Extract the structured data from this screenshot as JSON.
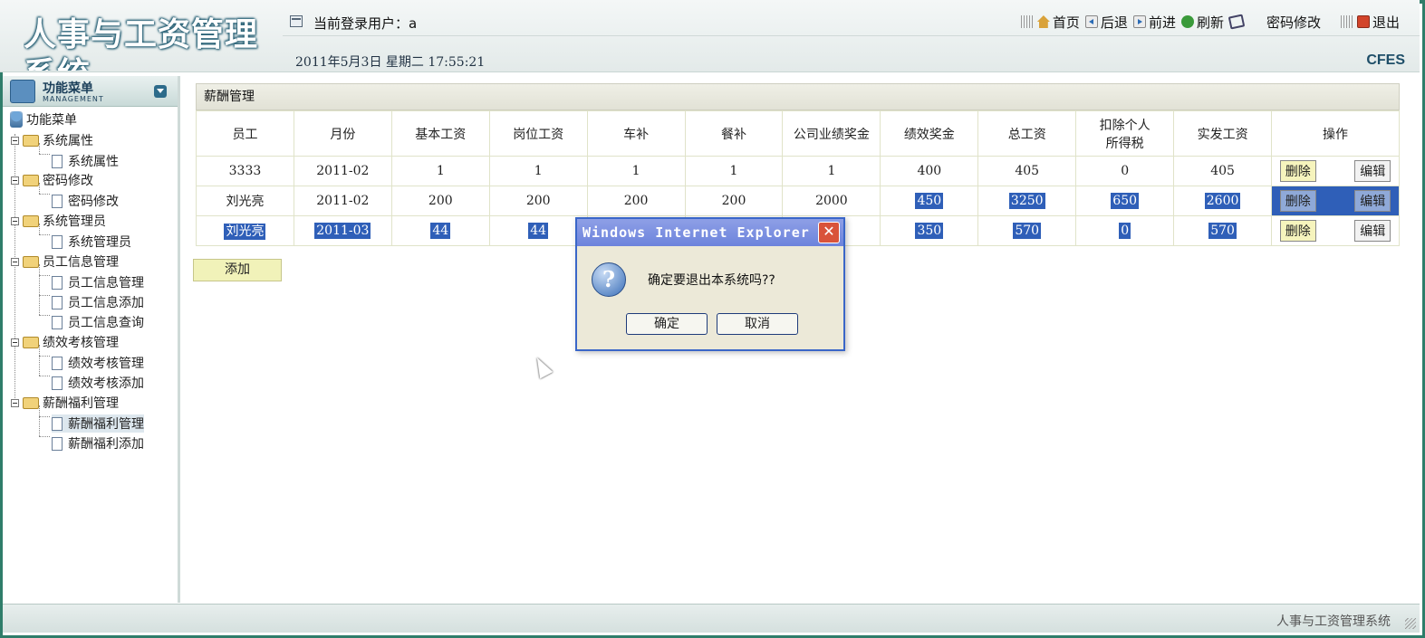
{
  "app": {
    "title": "人事与工资管理系统",
    "brand": "CFES",
    "date_line": "2011年5月3日  星期二  17:55:21"
  },
  "topbar": {
    "login_user": "当前登录用户：a",
    "nav": {
      "home": "首页",
      "back": "后退",
      "forward": "前进",
      "refresh": "刷新",
      "change_password": "密码修改",
      "logout": "退出"
    }
  },
  "sidebar": {
    "header_title": "功能菜单",
    "header_sub": "MANAGEMENT",
    "root": "功能菜单",
    "groups": [
      {
        "label": "系统属性",
        "children": [
          "系统属性"
        ]
      },
      {
        "label": "密码修改",
        "children": [
          "密码修改"
        ]
      },
      {
        "label": "系统管理员",
        "children": [
          "系统管理员"
        ]
      },
      {
        "label": "员工信息管理",
        "children": [
          "员工信息管理",
          "员工信息添加",
          "员工信息查询"
        ]
      },
      {
        "label": "绩效考核管理",
        "children": [
          "绩效考核管理",
          "绩效考核添加"
        ]
      },
      {
        "label": "薪酬福利管理",
        "children": [
          "薪酬福利管理",
          "薪酬福利添加"
        ]
      }
    ]
  },
  "main": {
    "panel_title": "薪酬管理",
    "columns": [
      "员工",
      "月份",
      "基本工资",
      "岗位工资",
      "车补",
      "餐补",
      "公司业绩奖金",
      "绩效奖金",
      "总工资",
      "扣除个人所得税",
      "实发工资",
      "操作"
    ],
    "rows": [
      [
        "3333",
        "2011-02",
        "1",
        "1",
        "1",
        "1",
        "1",
        "400",
        "405",
        "0",
        "405"
      ],
      [
        "刘光亮",
        "2011-02",
        "200",
        "200",
        "200",
        "200",
        "2000",
        "450",
        "3250",
        "650",
        "2600"
      ],
      [
        "刘光亮",
        "2011-03",
        "44",
        "44",
        "",
        "",
        "",
        "350",
        "570",
        "0",
        "570"
      ]
    ],
    "delete_label": "删除",
    "edit_label": "编辑",
    "add_label": "添加"
  },
  "dialog": {
    "title": "Windows Internet Explorer",
    "message": "确定要退出本系统吗??",
    "ok": "确定",
    "cancel": "取消",
    "close": "✕",
    "question_glyph": "?"
  },
  "footer": {
    "text": "人事与工资管理系统"
  },
  "colors": {
    "frame": "#2f7d6a",
    "selection": "#2f5fb8",
    "dialog_title": "#6c83dc"
  }
}
